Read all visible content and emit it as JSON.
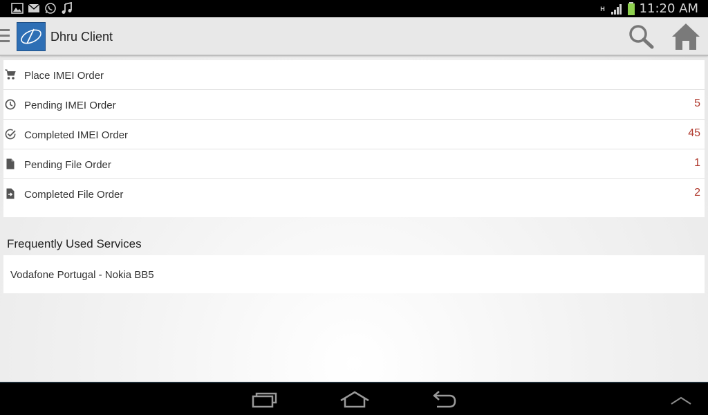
{
  "status_bar": {
    "icons": [
      "gallery-icon",
      "mail-icon",
      "whatsapp-icon",
      "music-icon"
    ],
    "network_type": "H",
    "time": "11:20 AM",
    "battery_color": "#8fd14f"
  },
  "action_bar": {
    "title": "Dhru Client",
    "logo_color": "#2e6fb5",
    "actions": [
      "search-icon",
      "home-icon"
    ]
  },
  "menu": {
    "items": [
      {
        "label": "Place IMEI Order",
        "count": "",
        "icon": "cart-icon"
      },
      {
        "label": "Pending IMEI Order",
        "count": "5",
        "icon": "clock-icon"
      },
      {
        "label": "Completed IMEI Order",
        "count": "45",
        "icon": "check-circle-icon"
      },
      {
        "label": "Pending File Order",
        "count": "1",
        "icon": "file-icon"
      },
      {
        "label": "Completed File Order",
        "count": "2",
        "icon": "file-arrow-icon"
      }
    ],
    "count_color": "#b03a2e"
  },
  "frequent": {
    "title": "Frequently Used Services",
    "items": [
      {
        "label": "Vodafone Portugal - Nokia BB5"
      }
    ]
  },
  "nav_bar": {
    "buttons": [
      "recent-apps-icon",
      "home-nav-icon",
      "back-icon",
      "chevron-up-icon"
    ]
  }
}
